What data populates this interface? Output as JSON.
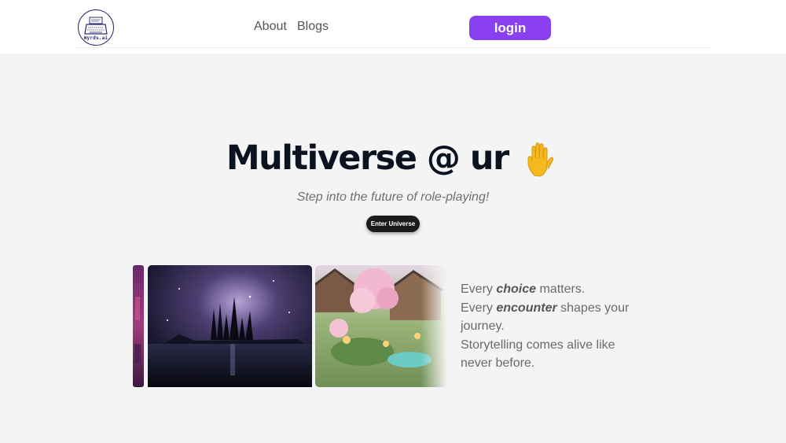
{
  "header": {
    "logo_text": "Wyrds.ai",
    "nav": [
      {
        "label": "About"
      },
      {
        "label": "Blogs"
      }
    ],
    "login_label": "login"
  },
  "hero": {
    "title": "Multiverse @ ur",
    "subtitle": "Step into the future of role-playing!",
    "cta_label": "Enter Universe"
  },
  "gallery": {
    "images": [
      {
        "name": "purple-fantasy-image"
      },
      {
        "name": "dark-cosmic-castle-image"
      },
      {
        "name": "cherry-blossom-village-image"
      }
    ]
  },
  "blurb": {
    "line1_pre": "Every ",
    "line1_em": "choice",
    "line1_post": " matters.",
    "line2_pre": "Every ",
    "line2_em": "encounter",
    "line2_post": " shapes your journey.",
    "line3": "Storytelling comes alive like never before."
  },
  "colors": {
    "accent": "#8a3ff0",
    "background": "#f4f4f4",
    "title": "#0b1320"
  }
}
